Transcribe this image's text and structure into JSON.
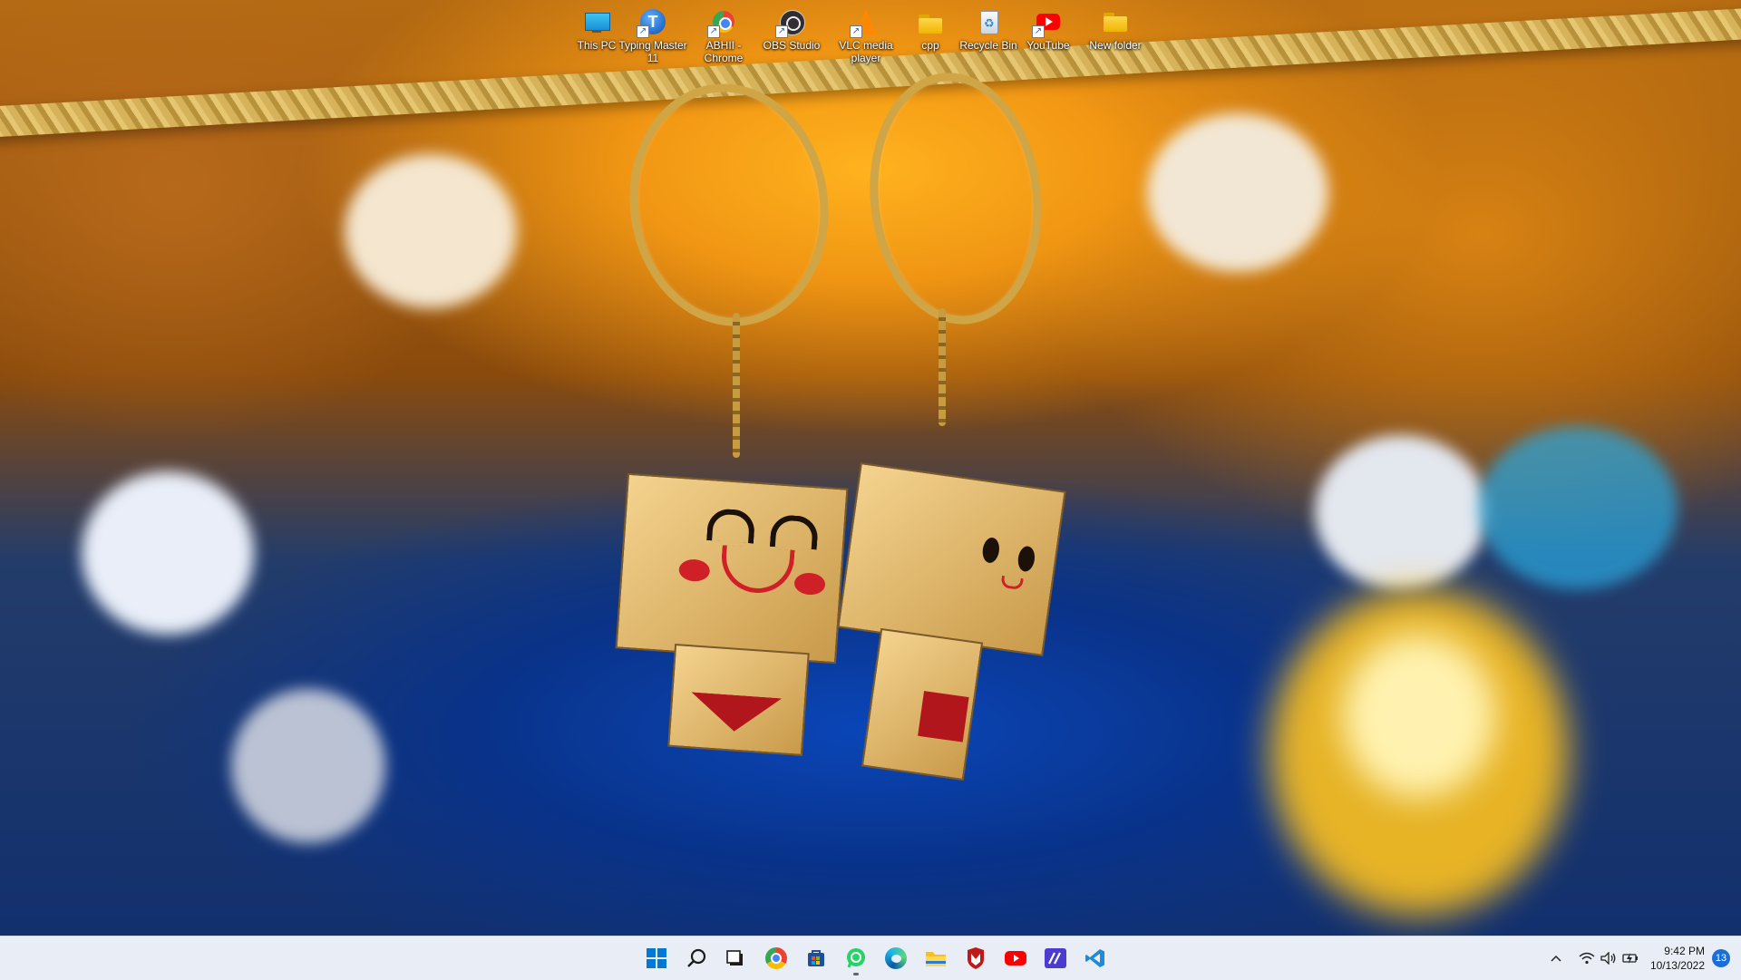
{
  "desktop": {
    "icons": [
      {
        "label": "This PC",
        "icon": "this-pc-icon"
      },
      {
        "label": "Typing Master 11",
        "icon": "typing-master-icon"
      },
      {
        "label": "ABHII - Chrome",
        "icon": "chrome-profile-icon"
      },
      {
        "label": "OBS Studio",
        "icon": "obs-studio-icon"
      },
      {
        "label": "VLC media player",
        "icon": "vlc-icon"
      },
      {
        "label": "cpp",
        "icon": "folder-icon"
      },
      {
        "label": "Recycle Bin",
        "icon": "recycle-bin-icon"
      },
      {
        "label": "YouTube",
        "icon": "youtube-icon"
      },
      {
        "label": "New folder",
        "icon": "folder-icon"
      }
    ]
  },
  "taskbar": {
    "apps": [
      {
        "name": "Start",
        "icon": "windows-start-icon"
      },
      {
        "name": "Search",
        "icon": "search-icon"
      },
      {
        "name": "Task View",
        "icon": "task-view-icon"
      },
      {
        "name": "Google Chrome",
        "icon": "chrome-icon"
      },
      {
        "name": "Microsoft Store",
        "icon": "store-icon"
      },
      {
        "name": "WhatsApp",
        "icon": "whatsapp-icon"
      },
      {
        "name": "Microsoft Edge",
        "icon": "edge-icon"
      },
      {
        "name": "File Explorer",
        "icon": "file-explorer-icon"
      },
      {
        "name": "McAfee",
        "icon": "mcafee-icon"
      },
      {
        "name": "YouTube",
        "icon": "youtube-icon"
      },
      {
        "name": "Notepad app",
        "icon": "pen-app-icon"
      },
      {
        "name": "Visual Studio Code",
        "icon": "vscode-icon"
      }
    ],
    "tray": {
      "time": "9:42 PM",
      "date": "10/13/2022",
      "notification_count": "13"
    }
  },
  "colors": {
    "taskbar_bg": "#e9eef6",
    "accent": "#1a6fd6"
  }
}
